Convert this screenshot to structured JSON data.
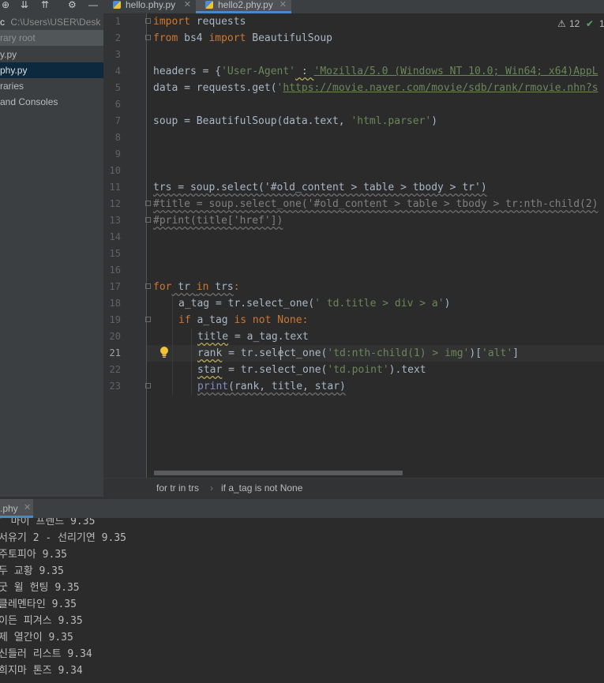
{
  "tabs": [
    {
      "label": "hello.phy.py",
      "active": false
    },
    {
      "label": "hello2.phy.py",
      "active": true
    }
  ],
  "project": {
    "root_label": "c",
    "root_path": "C:\\Users\\USER\\Desk",
    "library_root": "rary root",
    "items": [
      "y.py",
      "phy.py",
      "raries",
      "and Consoles"
    ]
  },
  "inspections": {
    "warnings": "12",
    "ok": "1"
  },
  "code": {
    "line_numbers": [
      "1",
      "2",
      "3",
      "4",
      "5",
      "6",
      "7",
      "8",
      "9",
      "10",
      "11",
      "12",
      "13",
      "14",
      "15",
      "16",
      "17",
      "18",
      "19",
      "20",
      "21",
      "22",
      "23"
    ],
    "current_line": "21",
    "l1": {
      "kw": "import",
      "rest": " requests"
    },
    "l2": {
      "kw1": "from",
      "mod": " bs4 ",
      "kw2": "import",
      "rest": " BeautifulSoup"
    },
    "l4": {
      "a": "headers = {",
      "s1": "'User-Agent'",
      "b": " : ",
      "s2": "'Mozilla/5.0 (Windows NT 10.0; Win64; x64)AppL"
    },
    "l5": {
      "a": "data = requests.get(",
      "q": "'",
      "url": "https://movie.naver.com/movie/sdb/rank/rmovie.nhn?s"
    },
    "l7": {
      "a": "soup = BeautifulSoup(data.text, ",
      "s": "'html.parser'",
      "b": ")"
    },
    "l11": "trs = soup.select('#old_content > table > tbody > tr')",
    "l12": "#title = soup.select_one('#old_content > table > tbody > tr:nth-child(2)",
    "l13": "#print(title['href'])",
    "l17": {
      "kw": "for",
      "a": " tr ",
      "kw2": "in",
      "b": " trs",
      "c": ":"
    },
    "l18": {
      "a": "a_tag = tr.select_one(",
      "s": "' td.title > div > a'",
      "b": ")"
    },
    "l19": {
      "kw": "if",
      "a": " a_tag ",
      "kw2": "is not",
      "kw3": " None",
      "b": ":"
    },
    "l20": {
      "a": "title",
      "b": " = a_tag.text"
    },
    "l21": {
      "a": "rank",
      "b": " = tr.select_one(",
      "s": "'td:nth-child(1) > img'",
      "c": ")[",
      "s2": "'alt'",
      "d": "]"
    },
    "l22": {
      "a": "star",
      "b": " = tr.select_one(",
      "s": "'td.point'",
      "c": ").text"
    },
    "l23": {
      "a": "print",
      "b": "(rank, title, star)"
    }
  },
  "breadcrumb": [
    "for tr in trs",
    "if a_tag is not None"
  ],
  "run": {
    "tab_label": ".phy",
    "output": [
      "′ 마이 프렌드 9.35",
      "서유기 2 - 선리기연 9.35",
      "주토피아 9.35",
      "두 교황 9.35",
      "굿 윌 헌팅 9.35",
      "클레멘타인 9.35",
      "이든 피겨스 9.35",
      "제 열간이 9.35",
      "신들러 리스트 9.34",
      "희지마 톤즈 9.34"
    ]
  },
  "colors": {
    "keyword": "#cc7832",
    "string": "#6a8759",
    "comment": "#808080",
    "background": "#2b2b2b"
  }
}
